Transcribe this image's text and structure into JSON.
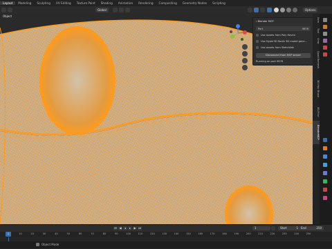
{
  "workspace_tabs": [
    "Layout",
    "Modeling",
    "Sculpting",
    "UV Editing",
    "Texture Paint",
    "Shading",
    "Animation",
    "Rendering",
    "Compositing",
    "Geometry Nodes",
    "Scripting"
  ],
  "active_tab_index": 0,
  "header": {
    "orientation": "Global",
    "options_label": "Options",
    "object_label": "Object"
  },
  "viewport": {
    "mesh_color": "#f19a2a",
    "background_color": "#cfc7bb"
  },
  "mcp_panel": {
    "title": "Blender MCP",
    "port_label": "Port",
    "port_value": "9876",
    "checkboxes": [
      "Use assets from Poly Haven",
      "Use Hyper3D Rodin 3D model gene...",
      "Use assets from Sketchfab"
    ],
    "disconnect_label": "Disconnect from MCP server",
    "status_text": "Running on port 9876"
  },
  "sidebar_tabs": [
    "Item",
    "Tool",
    "View",
    "Quad Remesh",
    "3D Hair Brush",
    "3D-Print",
    "BlenderMCP"
  ],
  "active_sidebar_tab": "BlenderMCP",
  "timeline": {
    "current_frame": "1",
    "start_label": "Start",
    "start_value": "1",
    "end_label": "End",
    "end_value": "250",
    "playhead_value": "1",
    "ticks": [
      "0",
      "10",
      "20",
      "30",
      "40",
      "50",
      "60",
      "70",
      "80",
      "90",
      "100",
      "110",
      "120",
      "130",
      "140",
      "150",
      "160",
      "170",
      "180",
      "190",
      "200",
      "210",
      "220",
      "230",
      "240",
      "250"
    ]
  },
  "status_bar": {
    "text": "Object Mode"
  }
}
